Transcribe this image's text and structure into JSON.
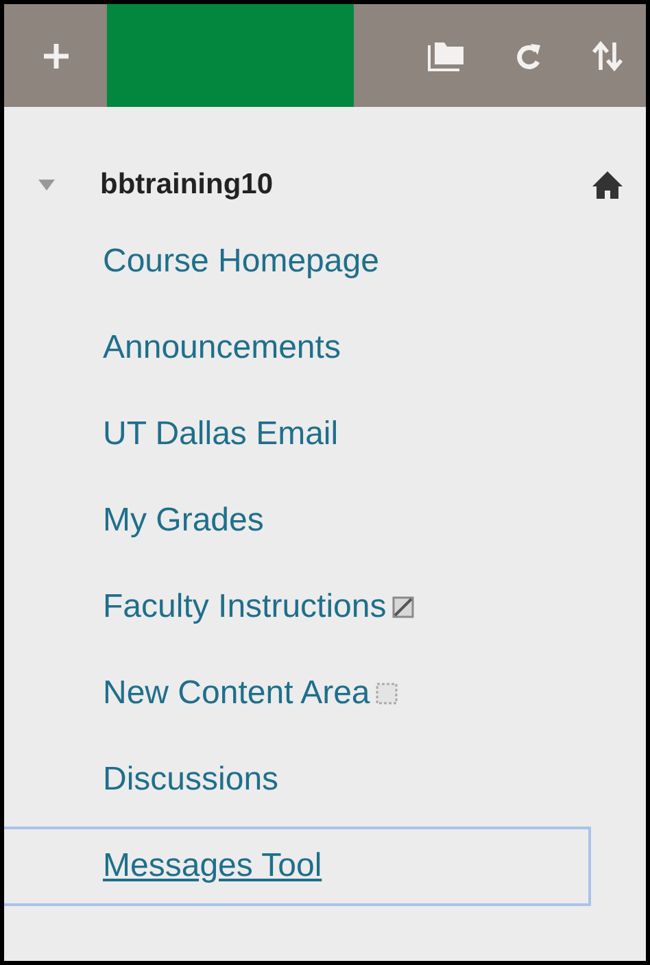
{
  "toolbar": {
    "buttons": [
      {
        "kind": "add"
      },
      {
        "kind": "folder"
      },
      {
        "kind": "refresh"
      },
      {
        "kind": "sort"
      }
    ]
  },
  "course": {
    "title": "bbtraining10",
    "expanded": true
  },
  "menu": [
    {
      "label": "Course Homepage",
      "kind": "plain",
      "selected": false
    },
    {
      "label": "Announcements",
      "kind": "plain",
      "selected": false
    },
    {
      "label": "UT Dallas Email",
      "kind": "plain",
      "selected": false
    },
    {
      "label": "My Grades",
      "kind": "plain",
      "selected": false
    },
    {
      "label": "Faculty Instructions",
      "kind": "hidden",
      "selected": false
    },
    {
      "label": "New Content Area",
      "kind": "empty",
      "selected": false
    },
    {
      "label": "Discussions",
      "kind": "plain",
      "selected": false
    },
    {
      "label": "Messages Tool",
      "kind": "plain",
      "selected": true
    }
  ]
}
